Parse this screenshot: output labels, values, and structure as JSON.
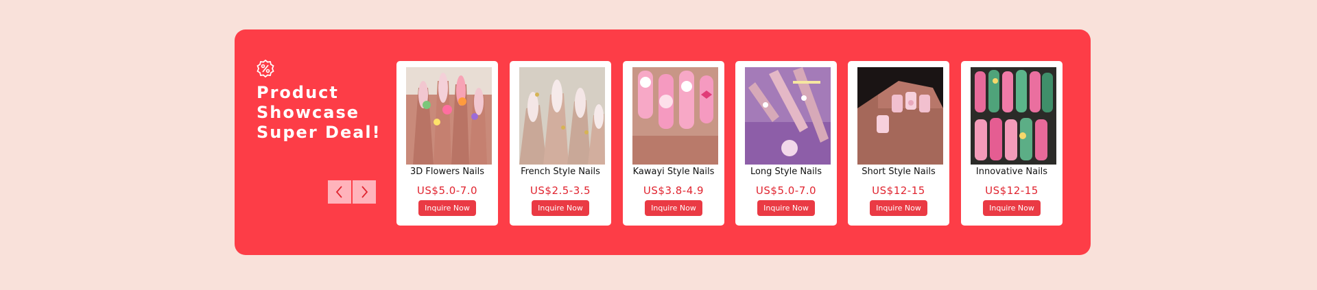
{
  "promo": {
    "icon": "discount-badge-icon",
    "title": "Product\nShowcase\nSuper  Deal!",
    "colors": {
      "panel": "#fd3d47",
      "background": "#f9e1da",
      "price": "#e0242f",
      "button": "#ea3a44"
    }
  },
  "carousel": {
    "prev_icon": "chevron-left-icon",
    "next_icon": "chevron-right-icon"
  },
  "products": [
    {
      "name": "3D Flowers Nails",
      "price": "US$5.0-7.0",
      "cta": "Inquire Now"
    },
    {
      "name": "French Style Nails",
      "price": "US$2.5-3.5",
      "cta": "Inquire Now"
    },
    {
      "name": "Kawayi Style Nails",
      "price": "US$3.8-4.9",
      "cta": "Inquire Now"
    },
    {
      "name": "Long Style Nails",
      "price": "US$5.0-7.0",
      "cta": "Inquire Now"
    },
    {
      "name": "Short Style Nails",
      "price": "US$12-15",
      "cta": "Inquire Now"
    },
    {
      "name": "Innovative Nails",
      "price": "US$12-15",
      "cta": "Inquire Now"
    }
  ]
}
